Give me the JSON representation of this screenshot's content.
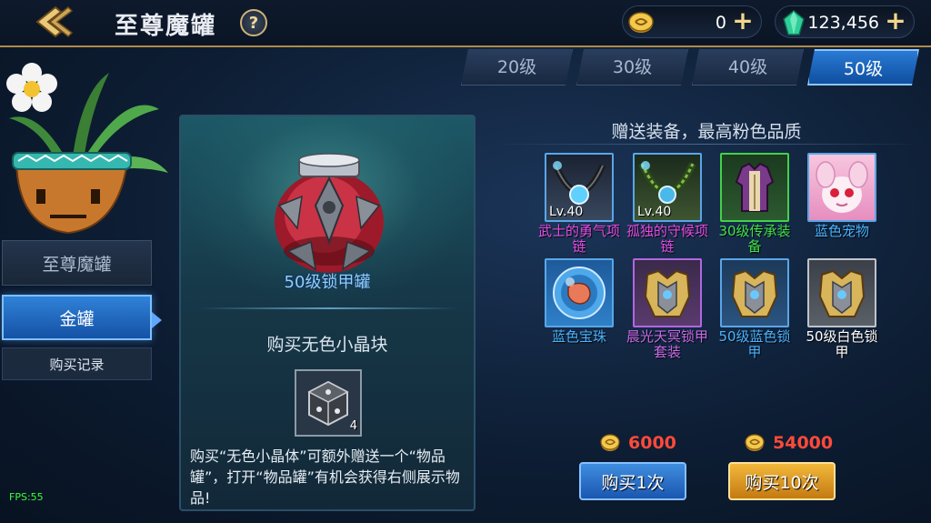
{
  "header": {
    "title": "至尊魔罐",
    "help_label": "?",
    "gold_value": "0",
    "gem_value": "123,456",
    "plus_label": "+"
  },
  "tabs": [
    {
      "label": "20级",
      "active": false
    },
    {
      "label": "30级",
      "active": false
    },
    {
      "label": "40级",
      "active": false
    },
    {
      "label": "50级",
      "active": true
    }
  ],
  "sidebar": {
    "items": [
      {
        "label": "至尊魔罐",
        "active": false
      },
      {
        "label": "金罐",
        "active": true
      }
    ],
    "record_label": "购买记录"
  },
  "fps": "FPS:55",
  "center": {
    "jar_name": "50级锁甲罐",
    "buy_title": "购买无色小晶块",
    "crystal_count": "4",
    "description": "购买“无色小晶体”可额外赠送一个“物品罐”，打开“物品罐”有机会获得右侧展示物品!"
  },
  "gift": {
    "title": "赠送装备，最高粉色品质",
    "items": [
      {
        "name": "武士的勇气项链",
        "level": "Lv.40",
        "quality": "blue",
        "name_color": "#e54ce6",
        "icon": "necklace-icon"
      },
      {
        "name": "孤独的守候项链",
        "level": "Lv.40",
        "quality": "blue",
        "name_color": "#e54ce6",
        "icon": "necklace-icon"
      },
      {
        "name": "30级传承装备",
        "level": "",
        "quality": "green",
        "name_color": "#42e04a",
        "icon": "armor-vest-icon"
      },
      {
        "name": "蓝色宠物",
        "level": "",
        "quality": "blue",
        "name_color": "#4ab3ff",
        "icon": "pet-icon"
      },
      {
        "name": "蓝色宝珠",
        "level": "",
        "quality": "blue",
        "name_color": "#4ab3ff",
        "icon": "orb-icon"
      },
      {
        "name": "晨光天冥锁甲套装",
        "level": "",
        "quality": "purple",
        "name_color": "#c66ae8",
        "icon": "chest-armor-icon"
      },
      {
        "name": "50级蓝色锁甲",
        "level": "",
        "quality": "blue",
        "name_color": "#4ab3ff",
        "icon": "chest-armor-icon"
      },
      {
        "name": "50级白色锁甲",
        "level": "",
        "quality": "white",
        "name_color": "#ffffff",
        "icon": "chest-armor-icon"
      }
    ]
  },
  "purchase": {
    "price_once": "6000",
    "price_ten": "54000",
    "buy_once_label": "购买1次",
    "buy_ten_label": "购买10次"
  }
}
